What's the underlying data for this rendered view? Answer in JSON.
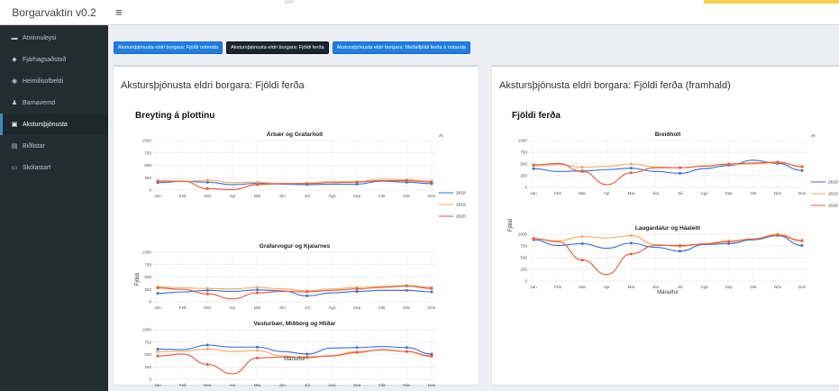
{
  "app": {
    "title": "Borgarvaktin v0.2",
    "menu_icon": "hamburger-icon",
    "accent_color": "#f6d04d"
  },
  "sidebar": {
    "items": [
      {
        "label": "Atvinnuleysi",
        "icon": "briefcase-icon",
        "glyph": "▬",
        "active": false
      },
      {
        "label": "Fjárhagsaðstoð",
        "icon": "money-icon",
        "glyph": "◆",
        "active": false
      },
      {
        "label": "Heimilisofbeldi",
        "icon": "eye-icon",
        "glyph": "◉",
        "active": false
      },
      {
        "label": "Barnavernd",
        "icon": "child-icon",
        "glyph": "♟",
        "active": false
      },
      {
        "label": "Akstursþjónusta",
        "icon": "bus-icon",
        "glyph": "▣",
        "active": true
      },
      {
        "label": "Biðlistar",
        "icon": "file-icon",
        "glyph": "▤",
        "active": false
      },
      {
        "label": "Skólastarf",
        "icon": "school-icon",
        "glyph": "▭",
        "active": false
      }
    ]
  },
  "tabs": [
    {
      "label": "Akstursþjónusta eldri borgara: Fjöldi notenda",
      "active": false
    },
    {
      "label": "Akstursþjónusta eldri borgara: Fjöldi ferða",
      "active": true
    },
    {
      "label": "Akstursþjónusta eldri borgara: Meðalfjöldi ferða á notanda",
      "active": false
    }
  ],
  "boxes": {
    "left_title": "Akstursþjónusta eldri borgara: Fjöldi ferða",
    "right_title": "Akstursþjónusta eldri borgara: Fjöldi ferða (framhald)"
  },
  "colors": {
    "2018": "#3a6fd3",
    "2019": "#f5a765",
    "2020": "#e65a3b"
  },
  "chart_data": [
    {
      "type": "line",
      "title": "Breyting á plottinu",
      "xlabel": "Mánuður",
      "ylabel": "Fjöldi",
      "legend_title": "Ár",
      "legend_position": "right",
      "x": [
        "Jan",
        "Feb",
        "Mar",
        "Apr",
        "Maí",
        "Jún",
        "Júl",
        "Ágú",
        "Sep",
        "Okt",
        "Nóv",
        "Des"
      ],
      "ylim": [
        0,
        1000
      ],
      "yticks": [
        0,
        250,
        500,
        750,
        1000
      ],
      "panels": [
        {
          "title": "Árbær og Grafarholt",
          "series": [
            {
              "name": "2018",
              "values": [
                150,
                175,
                160,
                110,
                135,
                120,
                110,
                120,
                120,
                180,
                160,
                130
              ]
            },
            {
              "name": "2019",
              "values": [
                190,
                170,
                200,
                150,
                160,
                130,
                140,
                170,
                170,
                220,
                210,
                180
              ]
            },
            {
              "name": "2020",
              "values": [
                180,
                180,
                30,
                10,
                110,
                130,
                130,
                150,
                160,
                190,
                190,
                160
              ]
            }
          ]
        },
        {
          "title": "Grafarvogur og Kjalarnes",
          "series": [
            {
              "name": "2018",
              "values": [
                170,
                200,
                230,
                210,
                240,
                220,
                120,
                180,
                210,
                230,
                230,
                200
              ]
            },
            {
              "name": "2019",
              "values": [
                300,
                280,
                270,
                260,
                290,
                260,
                220,
                260,
                290,
                310,
                330,
                290
              ]
            },
            {
              "name": "2020",
              "values": [
                280,
                250,
                160,
                60,
                180,
                210,
                200,
                230,
                260,
                290,
                320,
                270
              ]
            }
          ]
        },
        {
          "title": "Vesturbær, Miðborg og Hlíðar",
          "series": [
            {
              "name": "2018",
              "values": [
                610,
                600,
                690,
                650,
                650,
                560,
                510,
                630,
                640,
                660,
                640,
                510
              ]
            },
            {
              "name": "2019",
              "values": [
                560,
                570,
                610,
                560,
                580,
                470,
                430,
                480,
                560,
                590,
                560,
                460
              ]
            },
            {
              "name": "2020",
              "values": [
                470,
                510,
                300,
                110,
                430,
                450,
                450,
                470,
                540,
                600,
                560,
                470
              ]
            }
          ]
        }
      ]
    },
    {
      "type": "line",
      "title": "Fjöldi ferða",
      "xlabel": "Mánuður",
      "ylabel": "Fjöldi",
      "legend_title": "Ár",
      "legend_position": "right",
      "x": [
        "Jan",
        "Feb",
        "Mar",
        "Apr",
        "Maí",
        "Jún",
        "Júl",
        "Ágú",
        "Sep",
        "Okt",
        "Nóv",
        "Des"
      ],
      "ylim": [
        0,
        1000
      ],
      "yticks": [
        0,
        250,
        500,
        750,
        1000
      ],
      "panels": [
        {
          "title": "Breiðholt",
          "series": [
            {
              "name": "2018",
              "values": [
                400,
                340,
                350,
                380,
                410,
                340,
                300,
                400,
                470,
                580,
                510,
                360
              ]
            },
            {
              "name": "2019",
              "values": [
                460,
                490,
                430,
                450,
                500,
                440,
                420,
                460,
                490,
                500,
                530,
                450
              ]
            },
            {
              "name": "2020",
              "values": [
                480,
                510,
                340,
                60,
                310,
                420,
                420,
                450,
                500,
                520,
                540,
                440
              ]
            }
          ]
        },
        {
          "title": "Laugardalur og Háaleiti",
          "series": [
            {
              "name": "2018",
              "values": [
                880,
                760,
                800,
                700,
                810,
                720,
                640,
                780,
                800,
                880,
                970,
                760
              ]
            },
            {
              "name": "2019",
              "values": [
                900,
                860,
                950,
                920,
                970,
                780,
                740,
                800,
                860,
                900,
                1000,
                870
              ]
            },
            {
              "name": "2020",
              "values": [
                910,
                840,
                450,
                140,
                580,
                760,
                760,
                790,
                840,
                900,
                980,
                860
              ]
            }
          ]
        }
      ]
    }
  ]
}
